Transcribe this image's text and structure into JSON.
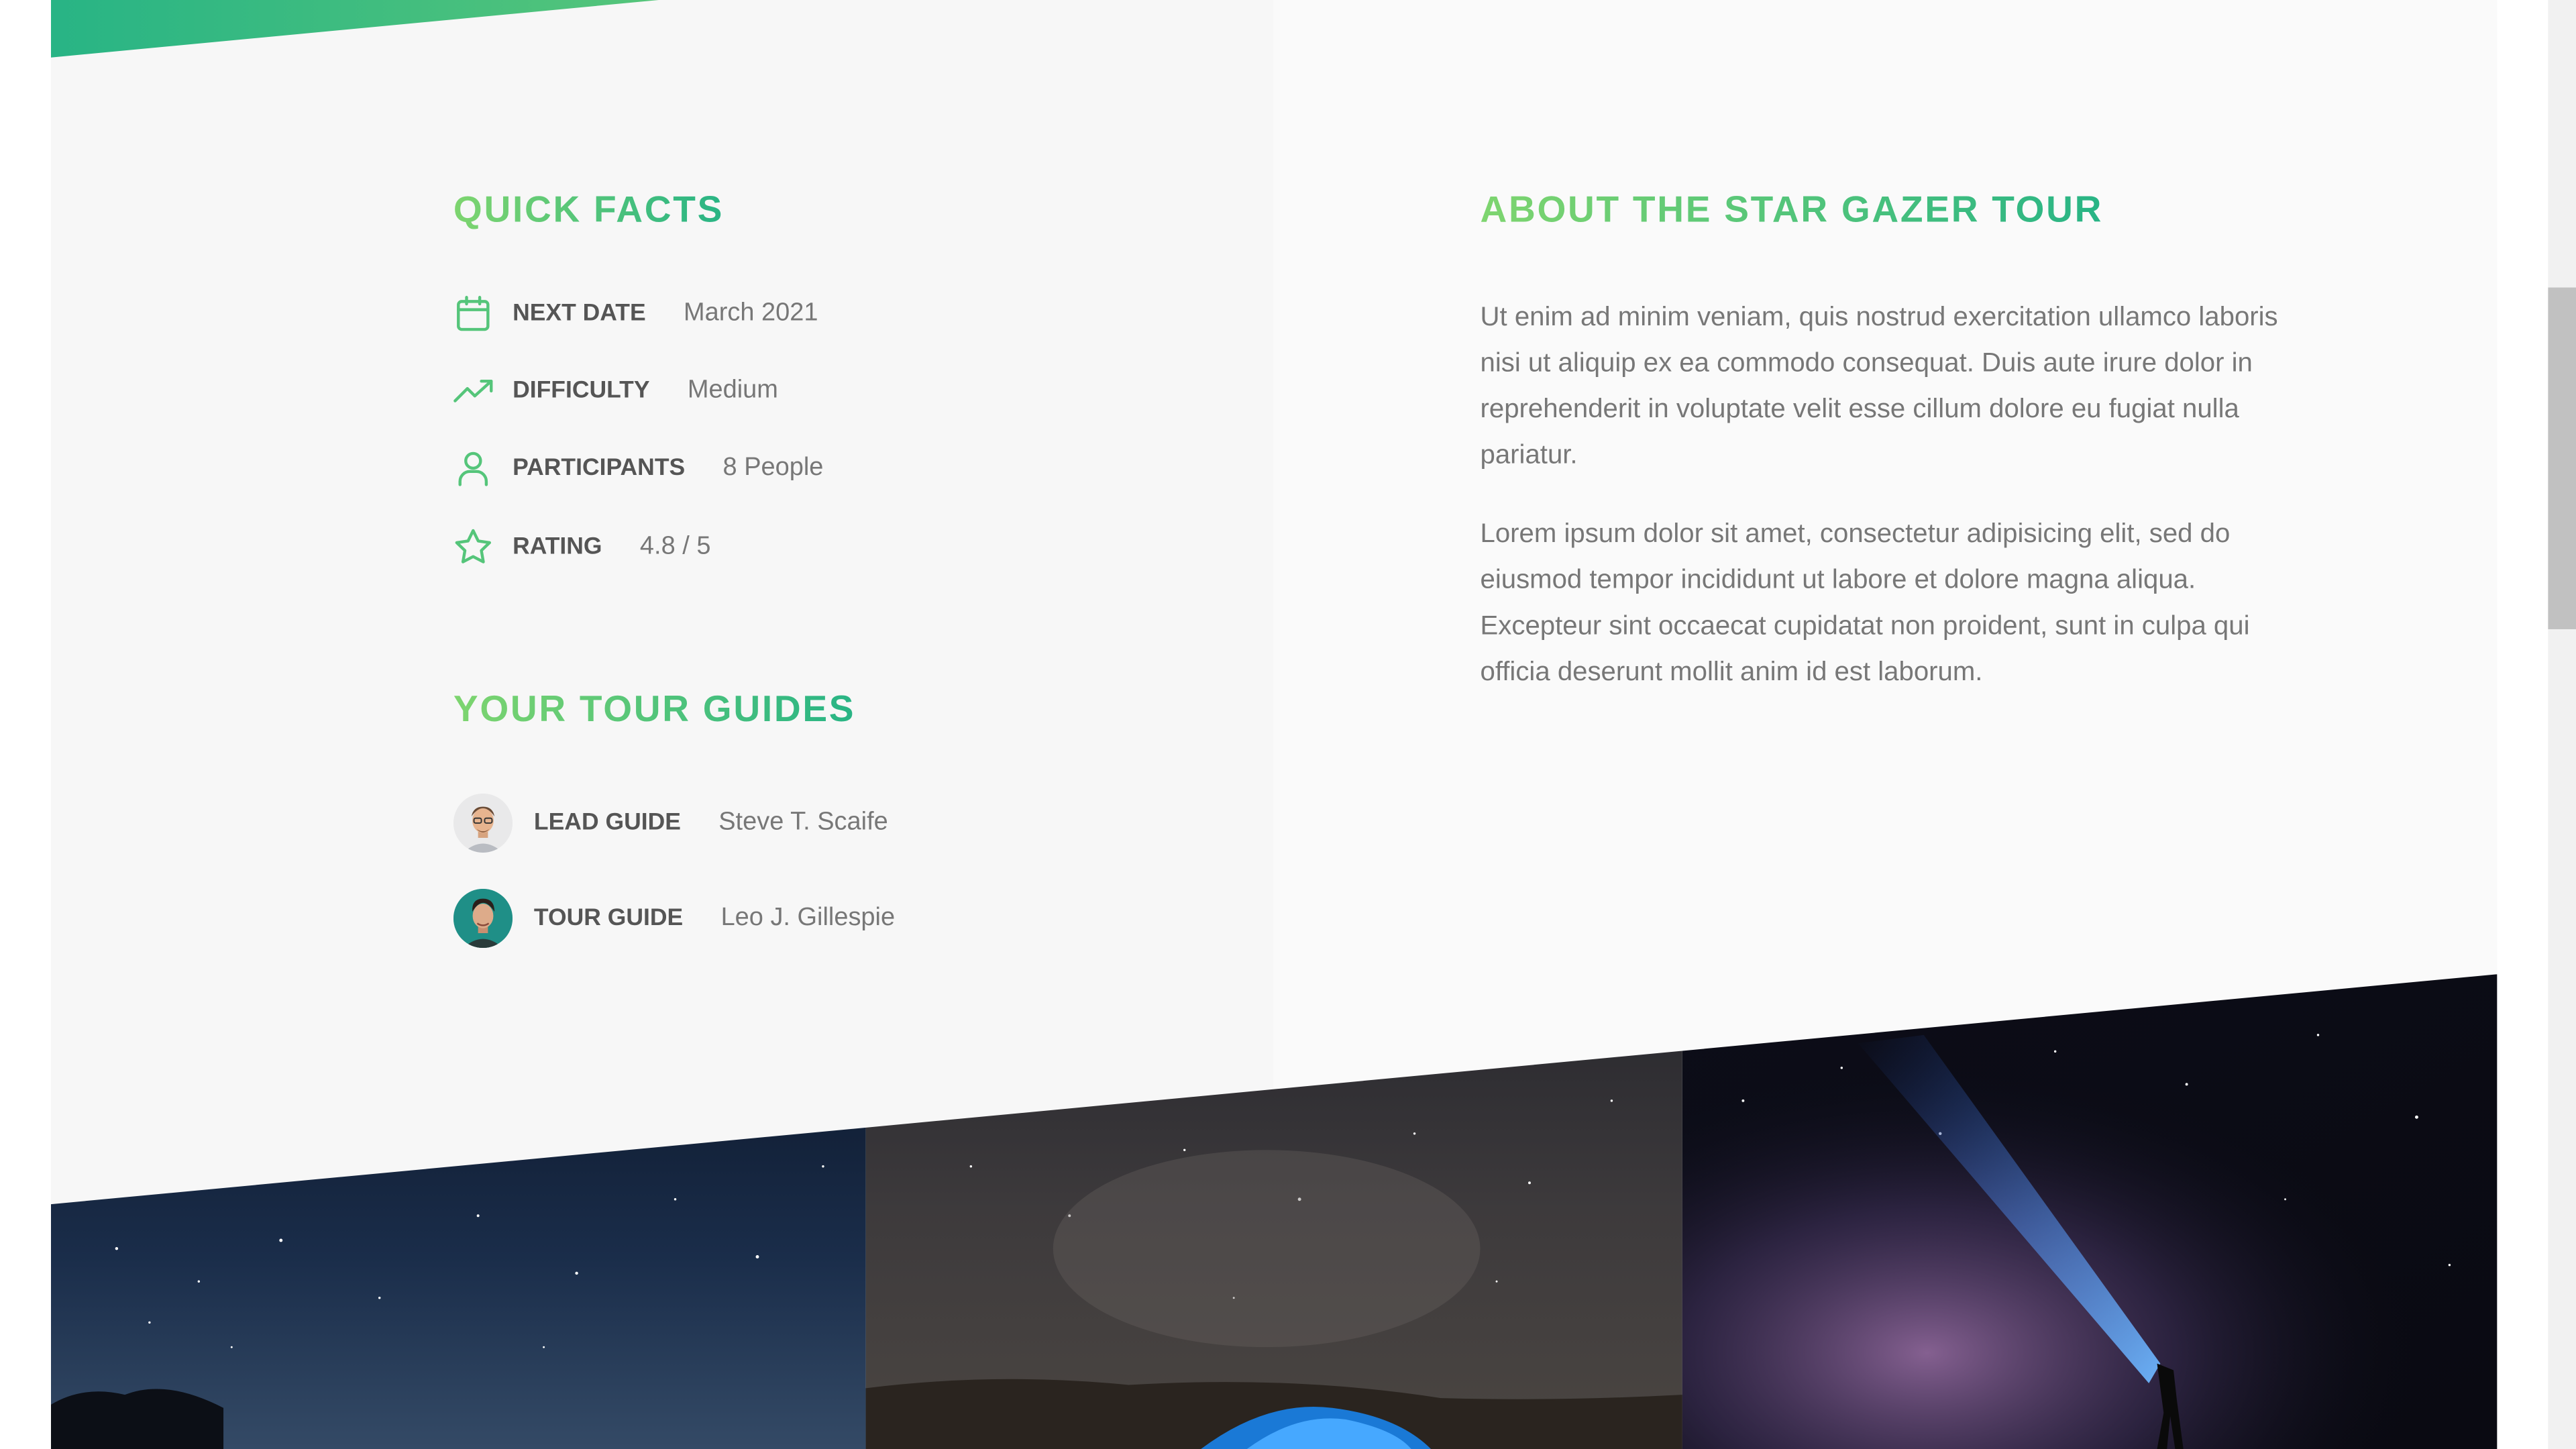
{
  "quick_facts": {
    "title": "QUICK FACTS",
    "items": [
      {
        "icon": "calendar-icon",
        "label": "NEXT DATE",
        "value": "March 2021"
      },
      {
        "icon": "trending-up-icon",
        "label": "DIFFICULTY",
        "value": "Medium"
      },
      {
        "icon": "user-icon",
        "label": "PARTICIPANTS",
        "value": "8 People"
      },
      {
        "icon": "star-icon",
        "label": "RATING",
        "value": "4.8 / 5"
      }
    ]
  },
  "guides": {
    "title": "YOUR TOUR GUIDES",
    "items": [
      {
        "role": "LEAD GUIDE",
        "name": "Steve T. Scaife"
      },
      {
        "role": "TOUR GUIDE",
        "name": "Leo J. Gillespie"
      }
    ]
  },
  "about": {
    "title": "ABOUT THE STAR GAZER TOUR",
    "paragraphs": [
      "Ut enim ad minim veniam, quis nostrud exercitation ullamco laboris nisi ut aliquip ex ea commodo consequat. Duis aute irure dolor in reprehenderit in voluptate velit esse cillum dolore eu fugiat nulla pariatur.",
      "Lorem ipsum dolor sit amet, consectetur adipisicing elit, sed do eiusmod tempor incididunt ut labore et dolore magna aliqua. Excepteur sint occaecat cupidatat non proident, sunt in culpa qui officia deserunt mollit anim id est laborum."
    ]
  },
  "gallery": {
    "images": [
      "starry-sky-photo",
      "camp-tent-milky-way-photo",
      "flashlight-milky-way-photo"
    ]
  },
  "colors": {
    "accent": "#55c57a",
    "accent_light": "#7ed56f",
    "accent_dark": "#28b485",
    "label": "#555555",
    "value": "#777777"
  }
}
